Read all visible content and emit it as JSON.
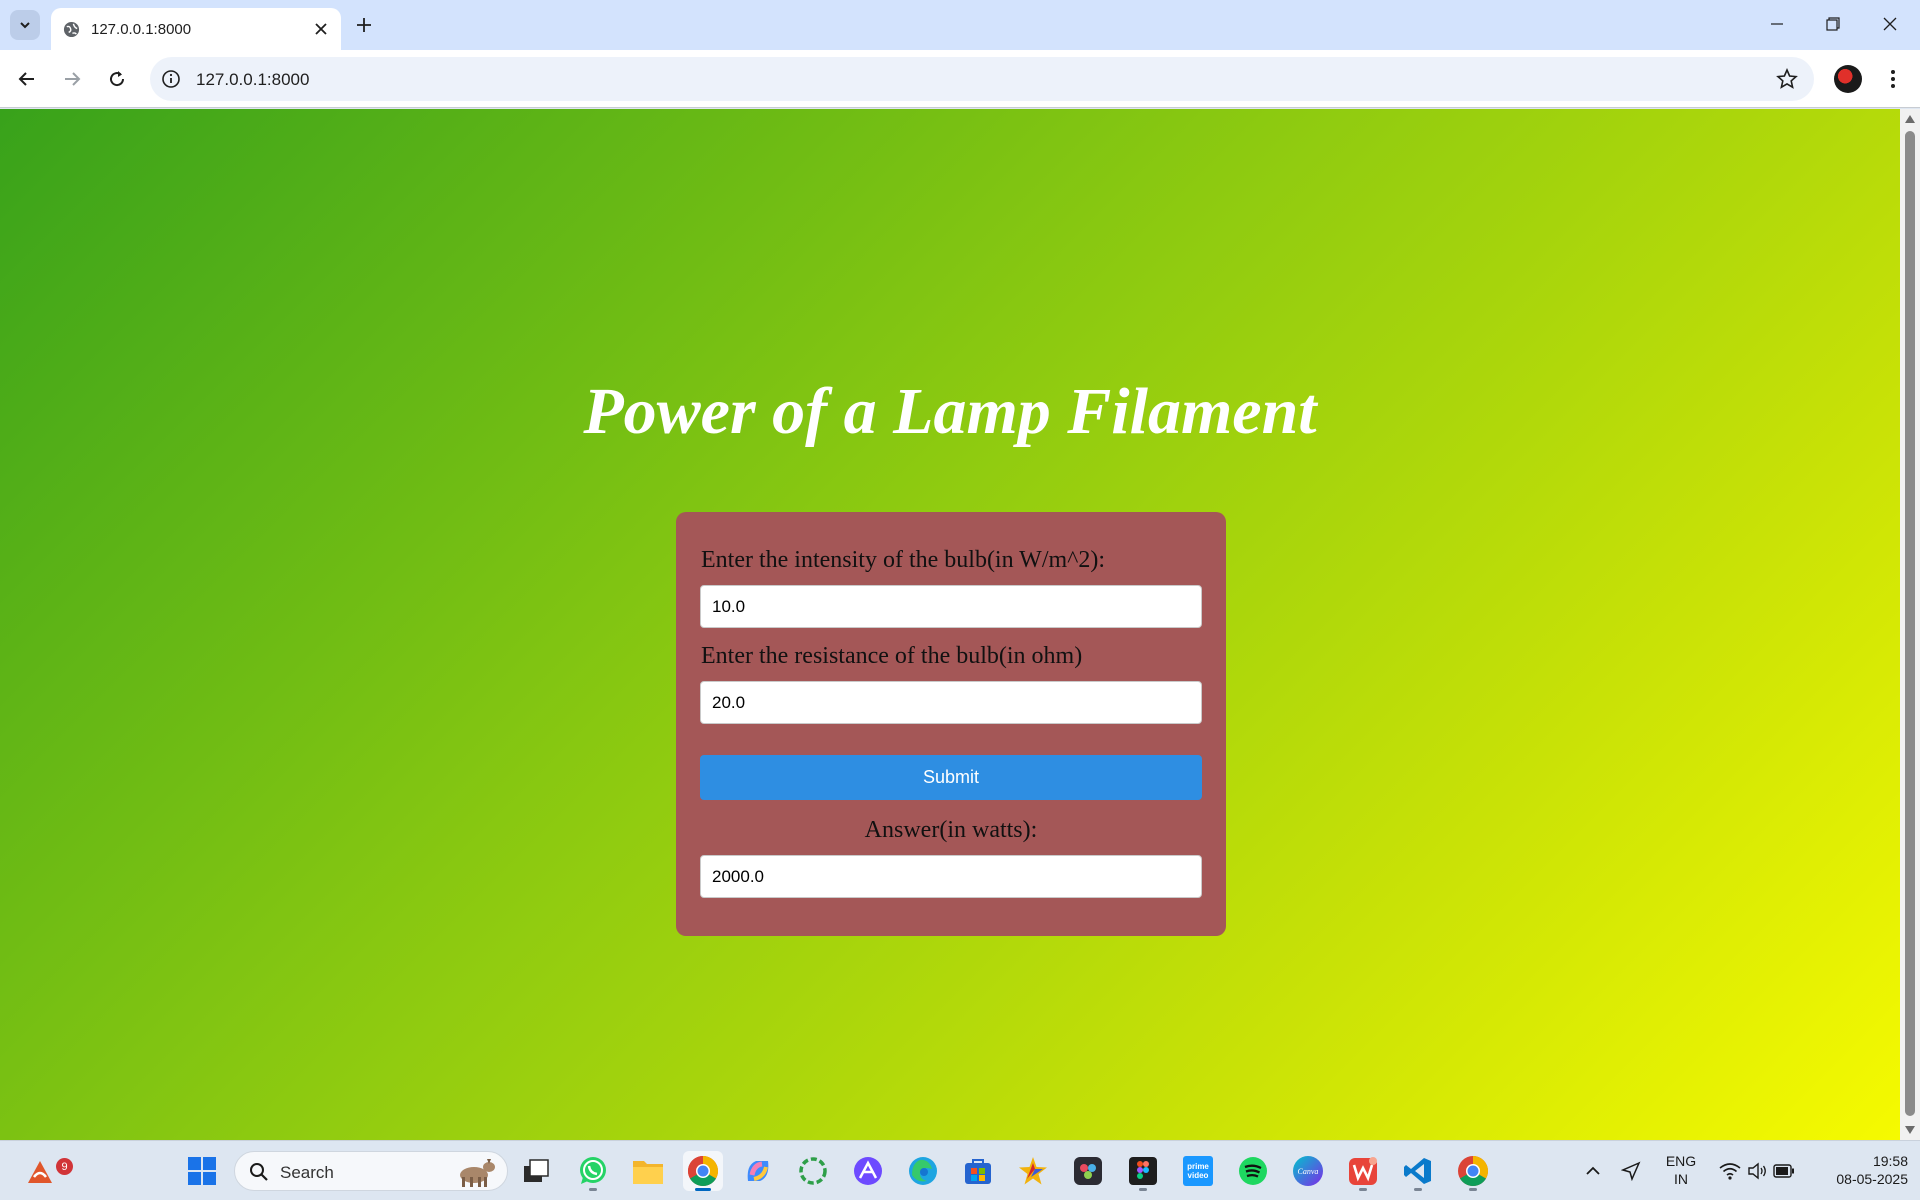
{
  "browser": {
    "tab": {
      "title": "127.0.0.1:8000"
    },
    "url": "127.0.0.1:8000"
  },
  "page": {
    "title": "Power of a Lamp Filament",
    "form": {
      "intensity_label": "Enter the intensity of the bulb(in W/m^2):",
      "intensity_value": "10.0",
      "resistance_label": "Enter the resistance of the bulb(in ohm)",
      "resistance_value": "20.0",
      "submit_label": "Submit",
      "answer_label": "Answer(in watts):",
      "answer_value": "2000.0"
    }
  },
  "taskbar": {
    "weather_badge": "9",
    "search_placeholder": "Search",
    "pinned_apps": [
      "start-icon",
      "task-view-icon",
      "whatsapp-icon",
      "file-explorer-icon",
      "chrome-icon",
      "copilot-icon",
      "spinner-app-icon",
      "proton-icon",
      "edge-icon",
      "store-icon",
      "star-app-icon",
      "davinci-resolve-icon",
      "figma-icon",
      "prime-video-icon",
      "spotify-icon",
      "canva-icon",
      "wps-office-icon",
      "vscode-icon",
      "chrome-icon"
    ],
    "prime_video_text": "prime video",
    "canva_text": "Canva",
    "tray": {
      "language_line1": "ENG",
      "language_line2": "IN",
      "time": "19:58",
      "date": "08-05-2025"
    }
  },
  "colors": {
    "tab_strip": "#d3e3fd",
    "page_gradient_start": "#38a21b",
    "page_gradient_end": "#f6fa00",
    "card": "#a45757",
    "submit_button": "#2e8ee2",
    "title_text": "#ffffff"
  }
}
